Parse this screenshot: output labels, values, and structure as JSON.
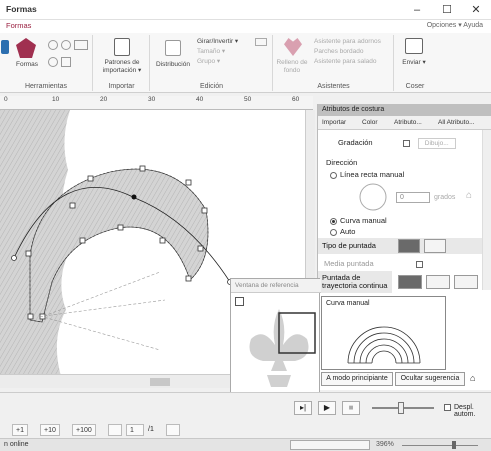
{
  "window": {
    "title": "Formas",
    "minimize": "–",
    "maximize": "☐",
    "close": "✕"
  },
  "ribbon": {
    "active_tab": "Formas",
    "right_links": "Opciones ▾ Ayuda",
    "groups": {
      "herramientas": {
        "label": "Herramientas",
        "formas_label": "Formas"
      },
      "importar": {
        "label": "Importar",
        "patterns_label": "Patrones de importación ▾"
      },
      "edicion": {
        "label": "Edición",
        "distribucion_label": "Distribución",
        "girar_label": "Girar/Invertir ▾",
        "tamano_label": "Tamaño ▾",
        "grupo_label": "Grupo ▾"
      },
      "asistentes": {
        "label": "Asistentes",
        "relleno_label": "Relleno de fondo",
        "item1": "Asistente para adornos",
        "item2": "Parches bordado",
        "item3": "Asistente para salado"
      },
      "coser": {
        "label": "Coser",
        "enviar_label": "Enviar ▾"
      }
    }
  },
  "ruler": {
    "ticks": [
      "0",
      "10",
      "20",
      "30",
      "40",
      "50",
      "60"
    ]
  },
  "panel": {
    "title": "Atributos de costura",
    "tabs": {
      "importar": "Importar",
      "color": "Color",
      "atributo": "Atributo...",
      "all": "All Atributo..."
    },
    "gradacion": "Gradación",
    "dibujo_btn": "Dibujo...",
    "direccion_header": "Dirección",
    "linea_recta": "Línea recta manual",
    "grados_value": "0",
    "grados_unit": "grados",
    "curva_manual": "Curva manual",
    "auto": "Auto",
    "tipo_puntada": "Tipo de puntada",
    "media_puntada": "Media puntada",
    "puntada_trayectoria": "Puntada de trayectoria continua"
  },
  "ref_window": {
    "title": "Ventana de referencia"
  },
  "tooltip": {
    "title": "Curva manual",
    "beginner_btn": "A modo principiante",
    "hide_btn": "Ocultar sugerencia"
  },
  "player": {
    "despl_label": "Despl. autom."
  },
  "nav": {
    "plus1": "+1",
    "plus10": "+10",
    "plus100": "+100",
    "page_value": "1",
    "page_total": "/1"
  },
  "status": {
    "text": "n online",
    "zoom": "396%"
  },
  "colors": {
    "accent": "#9a2040",
    "stitch_fill": "#c9c9c9",
    "selection": "#555555"
  }
}
